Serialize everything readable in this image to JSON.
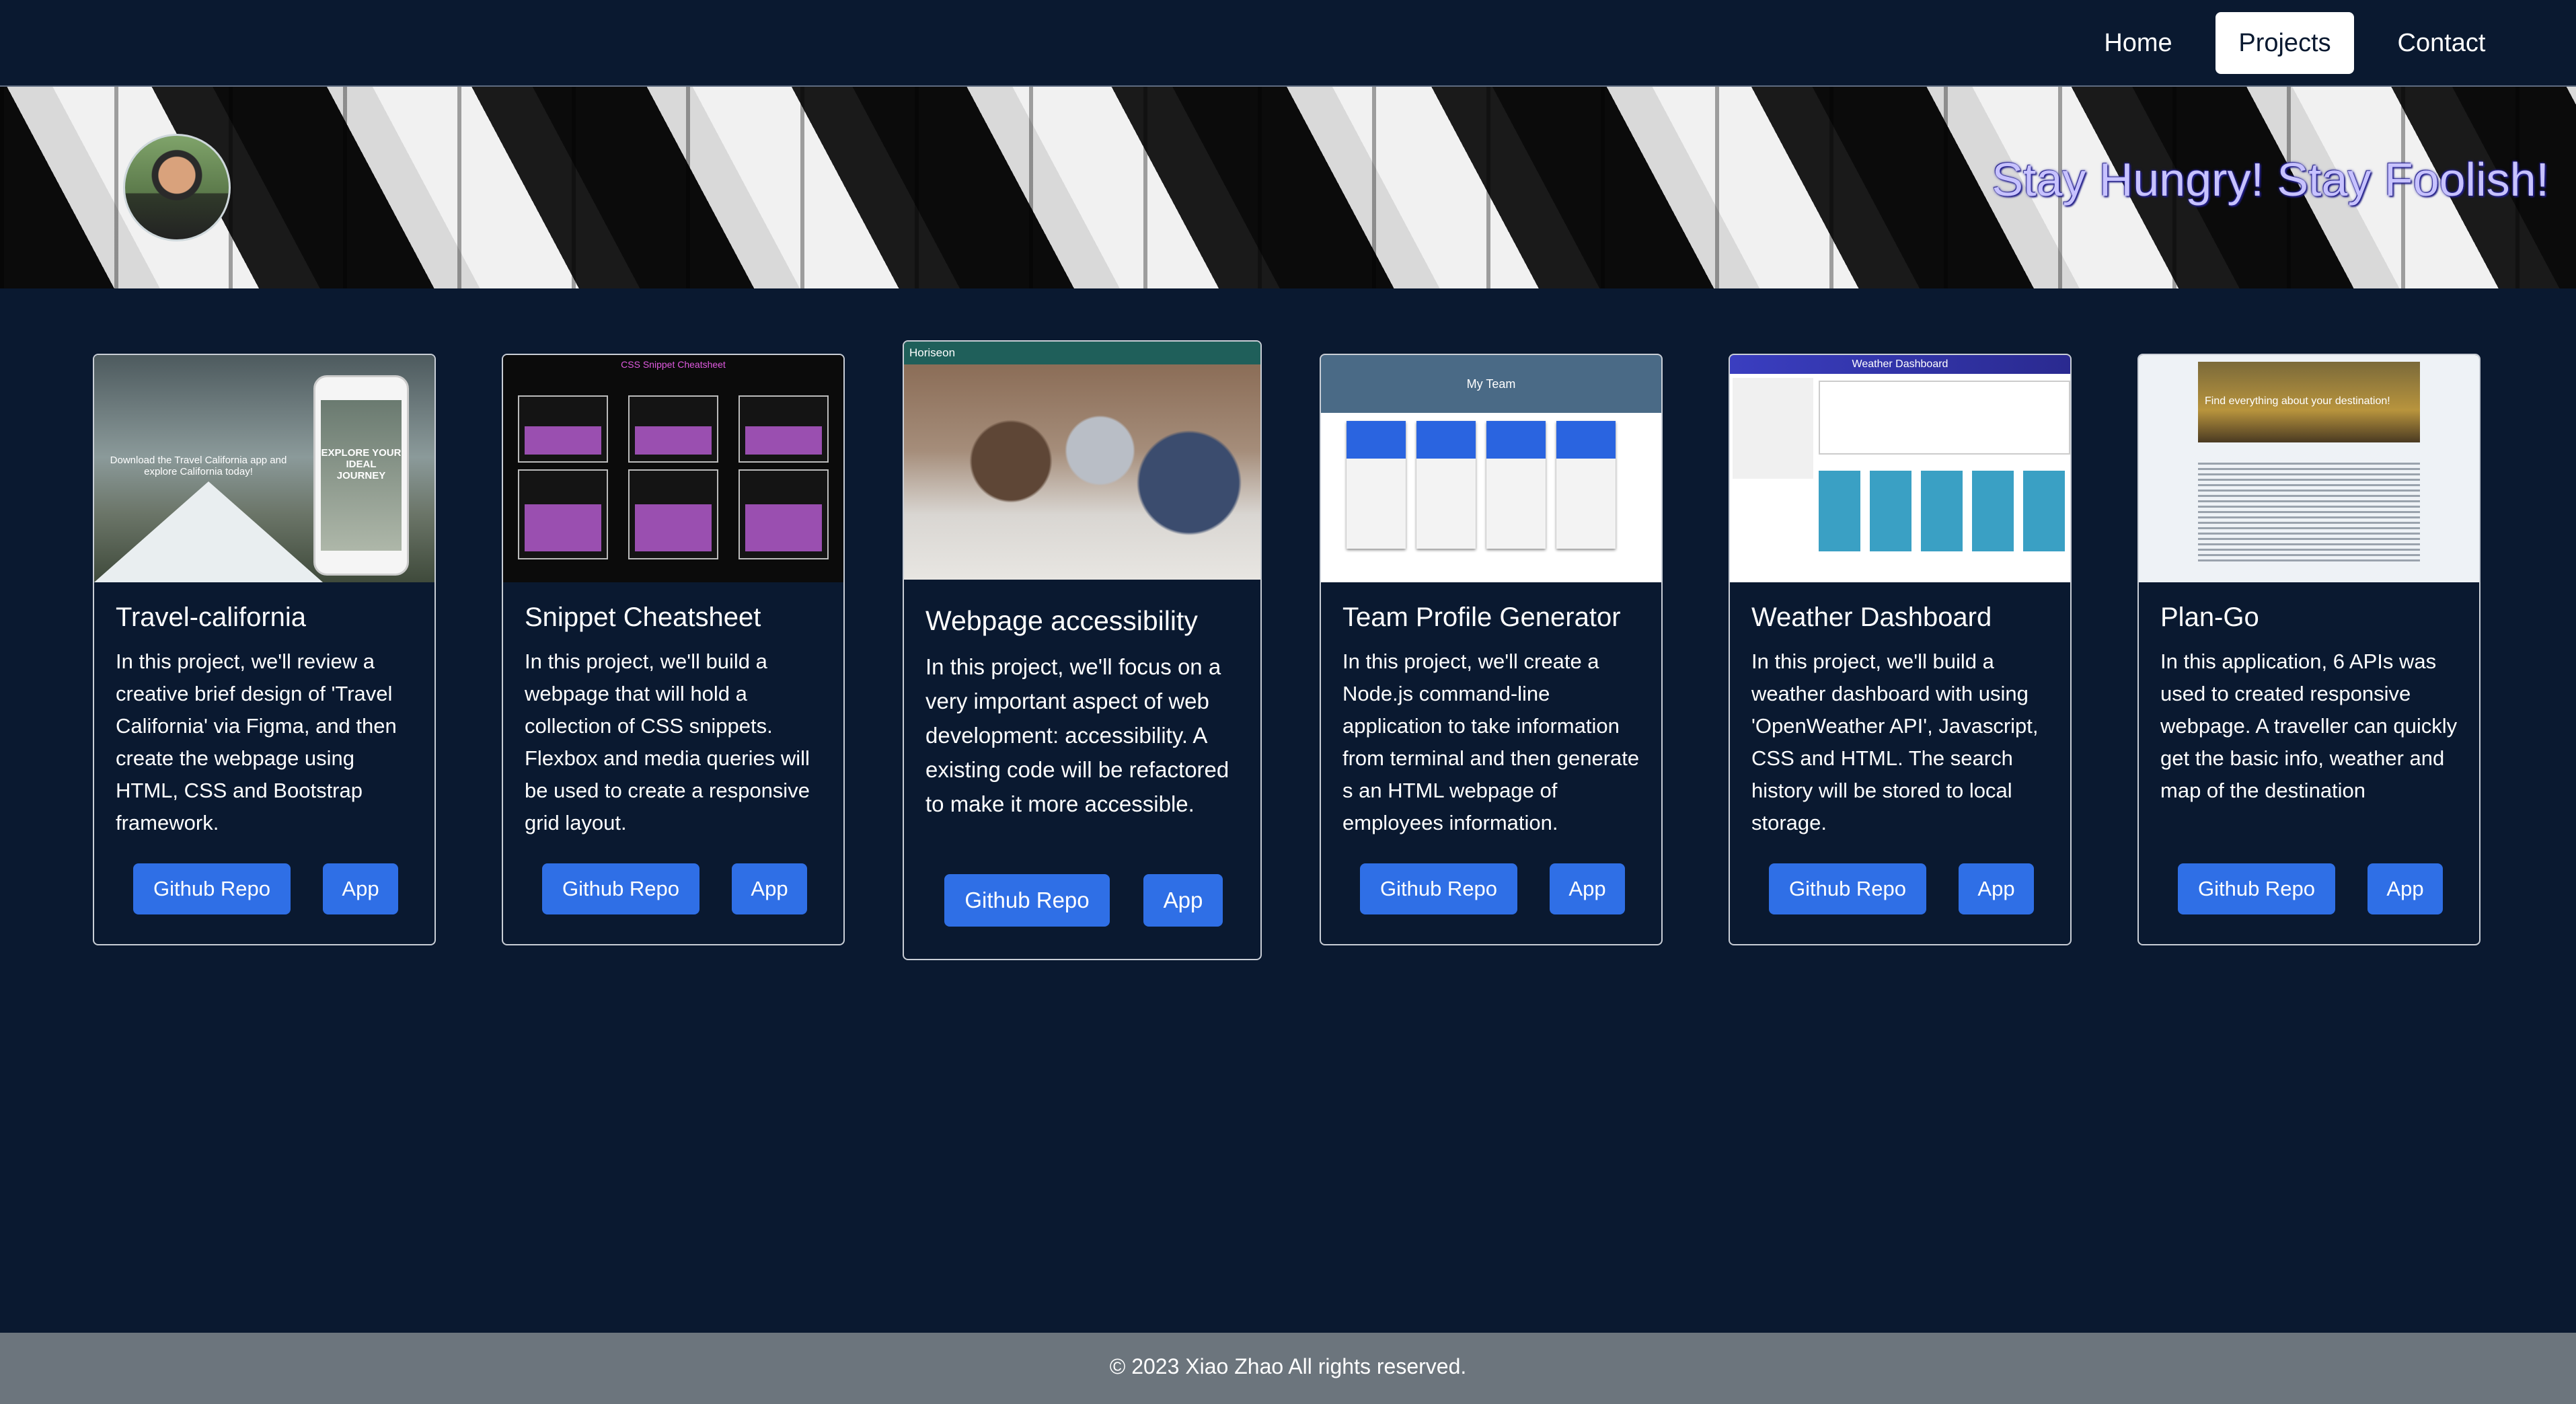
{
  "nav": {
    "items": [
      {
        "label": "Home",
        "active": false
      },
      {
        "label": "Projects",
        "active": true
      },
      {
        "label": "Contact",
        "active": false
      }
    ]
  },
  "hero": {
    "motto": "Stay Hungry! Stay Foolish!"
  },
  "projects": [
    {
      "title": "Travel-california",
      "description": "In this project, we'll review a creative brief design of 'Travel California' via Figma, and then create the webpage using HTML, CSS and Bootstrap framework.",
      "repo_label": "Github Repo",
      "app_label": "App",
      "thumb": {
        "download_text": "Download the Travel California app and explore California today!",
        "phone_text": "EXPLORE YOUR IDEAL JOURNEY"
      }
    },
    {
      "title": "Snippet Cheatsheet",
      "description": "In this project, we'll build a webpage that will hold a collection of CSS snippets. Flexbox and media queries will be used to create a responsive grid layout.",
      "repo_label": "Github Repo",
      "app_label": "App",
      "thumb": {
        "title": "CSS Snippet Cheatsheet"
      }
    },
    {
      "title": "Webpage accessibility",
      "description": "In this project, we'll focus on a very important aspect of web development: accessibility. A existing code will be refactored to make it more accessible.",
      "repo_label": "Github Repo",
      "app_label": "App",
      "thumb": {
        "brand": "Horiseon"
      }
    },
    {
      "title": "Team Profile Generator",
      "description": "In this project, we'll create a Node.js command-line application to take information from terminal and then generate s an HTML webpage of employees information.",
      "repo_label": "Github Repo",
      "app_label": "App",
      "thumb": {
        "header": "My Team"
      }
    },
    {
      "title": "Weather Dashboard",
      "description": "In this project, we'll build a weather dashboard with using 'OpenWeather API', Javascript, CSS and HTML. The search history will be stored to local storage.",
      "repo_label": "Github Repo",
      "app_label": "App",
      "thumb": {
        "header": "Weather Dashboard"
      }
    },
    {
      "title": "Plan-Go",
      "description": "In this application, 6 APIs was used to created responsive webpage. A traveller can quickly get the basic info, weather and map of the destination",
      "repo_label": "Github Repo",
      "app_label": "App",
      "thumb": {
        "banner": "Find everything about your destination!"
      }
    }
  ],
  "footer": {
    "text": "© 2023 Xiao Zhao All rights reserved."
  },
  "colors": {
    "background": "#0a1930",
    "button": "#2f6fe6",
    "footer": "#6c757d",
    "motto": "#c7c2ff"
  }
}
